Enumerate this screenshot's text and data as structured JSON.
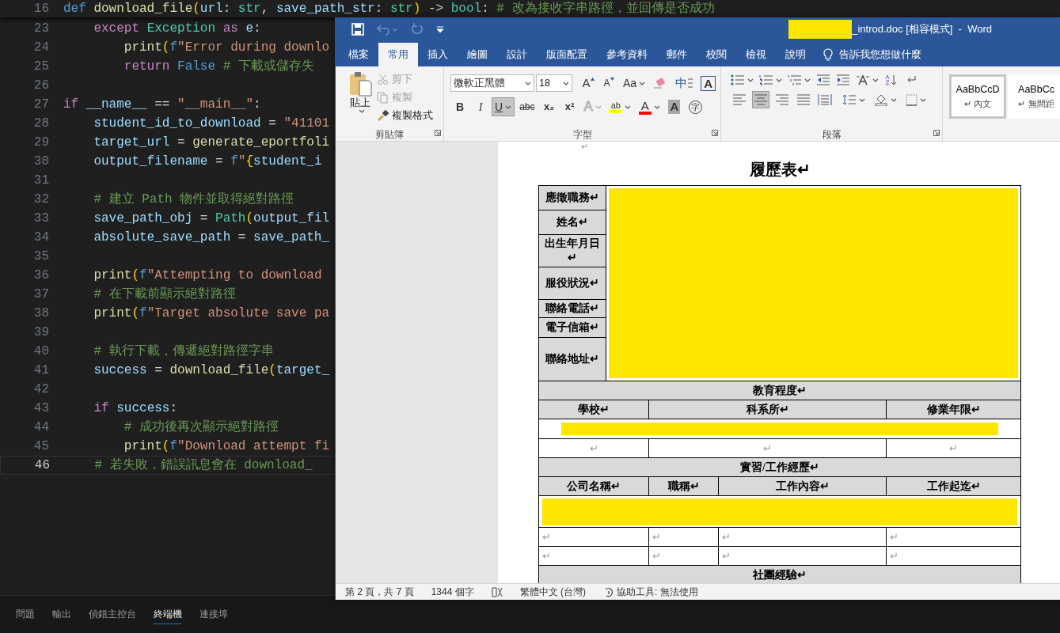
{
  "editor": {
    "sticky_line": {
      "number": "16",
      "current": false,
      "segments": [
        {
          "text": "def ",
          "kind": "keyword"
        },
        {
          "text": "download_file",
          "kind": "function"
        },
        {
          "text": "(",
          "kind": "bracket"
        },
        {
          "text": "url",
          "kind": "variable"
        },
        {
          "text": ": ",
          "kind": "plain"
        },
        {
          "text": "str",
          "kind": "type"
        },
        {
          "text": ", ",
          "kind": "plain"
        },
        {
          "text": "save_path_str",
          "kind": "variable"
        },
        {
          "text": ": ",
          "kind": "plain"
        },
        {
          "text": "str",
          "kind": "type"
        },
        {
          "text": ")",
          "kind": "bracket"
        },
        {
          "text": " -> ",
          "kind": "plain"
        },
        {
          "text": "bool",
          "kind": "type"
        },
        {
          "text": ": ",
          "kind": "plain"
        },
        {
          "text": "# 改為接收字串路徑，並回傳是否成功",
          "kind": "comment"
        }
      ]
    },
    "lines": [
      {
        "number": "23",
        "current": false,
        "segments": [
          {
            "text": "    except ",
            "kind": "control"
          },
          {
            "text": "Exception",
            "kind": "type"
          },
          {
            "text": " as ",
            "kind": "control"
          },
          {
            "text": "e",
            "kind": "variable"
          },
          {
            "text": ":",
            "kind": "plain"
          }
        ]
      },
      {
        "number": "24",
        "current": false,
        "segments": [
          {
            "text": "        print",
            "kind": "function"
          },
          {
            "text": "(",
            "kind": "bracket"
          },
          {
            "text": "f",
            "kind": "keyword"
          },
          {
            "text": "\"Error during downlo",
            "kind": "string"
          }
        ]
      },
      {
        "number": "25",
        "current": false,
        "segments": [
          {
            "text": "        return ",
            "kind": "control"
          },
          {
            "text": "False",
            "kind": "keyword"
          },
          {
            "text": " # 下載或儲存失",
            "kind": "comment"
          }
        ]
      },
      {
        "number": "26",
        "current": false
      },
      {
        "number": "27",
        "current": false,
        "segments": [
          {
            "text": "if ",
            "kind": "control"
          },
          {
            "text": "__name__",
            "kind": "variable"
          },
          {
            "text": " == ",
            "kind": "plain"
          },
          {
            "text": "\"__main__\"",
            "kind": "string"
          },
          {
            "text": ":",
            "kind": "plain"
          }
        ]
      },
      {
        "number": "28",
        "current": false,
        "segments": [
          {
            "text": "    student_id_to_download",
            "kind": "variable"
          },
          {
            "text": " = ",
            "kind": "plain"
          },
          {
            "text": "\"41101",
            "kind": "string"
          }
        ]
      },
      {
        "number": "29",
        "current": false,
        "segments": [
          {
            "text": "    target_url",
            "kind": "variable"
          },
          {
            "text": " = ",
            "kind": "plain"
          },
          {
            "text": "generate_eportfoli",
            "kind": "function"
          }
        ]
      },
      {
        "number": "30",
        "current": false,
        "segments": [
          {
            "text": "    output_filename",
            "kind": "variable"
          },
          {
            "text": " = ",
            "kind": "plain"
          },
          {
            "text": "f",
            "kind": "keyword"
          },
          {
            "text": "\"",
            "kind": "string"
          },
          {
            "text": "{",
            "kind": "bracket"
          },
          {
            "text": "student_i",
            "kind": "variable"
          }
        ]
      },
      {
        "number": "31",
        "current": false
      },
      {
        "number": "32",
        "current": false,
        "segments": [
          {
            "text": "    # 建立 Path 物件並取得絕對路徑",
            "kind": "comment"
          }
        ]
      },
      {
        "number": "33",
        "current": false,
        "segments": [
          {
            "text": "    save_path_obj",
            "kind": "variable"
          },
          {
            "text": " = ",
            "kind": "plain"
          },
          {
            "text": "Path",
            "kind": "type"
          },
          {
            "text": "(",
            "kind": "bracket"
          },
          {
            "text": "output_fil",
            "kind": "variable"
          }
        ]
      },
      {
        "number": "34",
        "current": false,
        "segments": [
          {
            "text": "    absolute_save_path",
            "kind": "variable"
          },
          {
            "text": " = ",
            "kind": "plain"
          },
          {
            "text": "save_path_",
            "kind": "variable"
          }
        ]
      },
      {
        "number": "35",
        "current": false
      },
      {
        "number": "36",
        "current": false,
        "segments": [
          {
            "text": "    print",
            "kind": "function"
          },
          {
            "text": "(",
            "kind": "bracket"
          },
          {
            "text": "f",
            "kind": "keyword"
          },
          {
            "text": "\"Attempting to download",
            "kind": "string"
          }
        ]
      },
      {
        "number": "37",
        "current": false,
        "segments": [
          {
            "text": "    # 在下載前顯示絕對路徑",
            "kind": "comment"
          }
        ]
      },
      {
        "number": "38",
        "current": false,
        "segments": [
          {
            "text": "    print",
            "kind": "function"
          },
          {
            "text": "(",
            "kind": "bracket"
          },
          {
            "text": "f",
            "kind": "keyword"
          },
          {
            "text": "\"Target absolute save pa",
            "kind": "string"
          }
        ]
      },
      {
        "number": "39",
        "current": false
      },
      {
        "number": "40",
        "current": false,
        "segments": [
          {
            "text": "    # 執行下載，傳遞絕對路徑字串",
            "kind": "comment"
          }
        ]
      },
      {
        "number": "41",
        "current": false,
        "segments": [
          {
            "text": "    success",
            "kind": "variable"
          },
          {
            "text": " = ",
            "kind": "plain"
          },
          {
            "text": "download_file",
            "kind": "function"
          },
          {
            "text": "(",
            "kind": "bracket"
          },
          {
            "text": "target_",
            "kind": "variable"
          }
        ]
      },
      {
        "number": "42",
        "current": false
      },
      {
        "number": "43",
        "current": false,
        "segments": [
          {
            "text": "    if ",
            "kind": "control"
          },
          {
            "text": "success",
            "kind": "variable"
          },
          {
            "text": ":",
            "kind": "plain"
          }
        ]
      },
      {
        "number": "44",
        "current": false,
        "segments": [
          {
            "text": "        # 成功後再次顯示絕對路徑",
            "kind": "comment"
          }
        ]
      },
      {
        "number": "45",
        "current": false,
        "segments": [
          {
            "text": "        print",
            "kind": "function"
          },
          {
            "text": "(",
            "kind": "bracket"
          },
          {
            "text": "f",
            "kind": "keyword"
          },
          {
            "text": "\"Download attempt fi",
            "kind": "string"
          }
        ]
      },
      {
        "number": "46",
        "current": true,
        "segments": [
          {
            "text": "    # 若失敗，錯誤訊息會在 download_",
            "kind": "comment"
          }
        ]
      }
    ]
  },
  "panel_tabs": [
    {
      "label": "問題",
      "selected": false
    },
    {
      "label": "輸出",
      "selected": false
    },
    {
      "label": "偵錯主控台",
      "selected": false
    },
    {
      "label": "終端機",
      "selected": true
    },
    {
      "label": "連接埠",
      "selected": false
    }
  ],
  "word": {
    "quick_access": [
      {
        "kind": "save",
        "disabled": false
      },
      {
        "kind": "undo",
        "disabled": true
      },
      {
        "kind": "redo",
        "disabled": true
      },
      {
        "kind": "customize",
        "disabled": false
      }
    ],
    "title": "_introd.doc [相容模式]  -  Word",
    "tabs": [
      {
        "label": "檔案",
        "selected": false
      },
      {
        "label": "常用",
        "selected": true
      },
      {
        "label": "插入",
        "selected": false
      },
      {
        "label": "繪圖",
        "selected": false
      },
      {
        "label": "設計",
        "selected": false
      },
      {
        "label": "版面配置",
        "selected": false
      },
      {
        "label": "參考資料",
        "selected": false
      },
      {
        "label": "郵件",
        "selected": false
      },
      {
        "label": "校閱",
        "selected": false
      },
      {
        "label": "檢視",
        "selected": false
      },
      {
        "label": "說明",
        "selected": false
      }
    ],
    "tell_me": "告訴我您想做什麼",
    "clipboard": {
      "paste": "貼上",
      "items": [
        {
          "label": "剪下",
          "kind": "cut",
          "disabled": true
        },
        {
          "label": "複製",
          "kind": "copy",
          "disabled": true
        },
        {
          "label": "複製格式",
          "kind": "format_painter",
          "disabled": false
        }
      ],
      "label": "剪貼簿"
    },
    "font": {
      "font_name": "微軟正黑體",
      "font_size": "18",
      "label": "字型",
      "row1": [
        {
          "label": "A",
          "kind": "grow",
          "pressed": false
        },
        {
          "label": "A",
          "kind": "shrink",
          "pressed": false
        },
        {
          "label": "Aa",
          "kind": "case",
          "pressed": false
        },
        {
          "kind": "clear",
          "pressed": false
        },
        {
          "label": "中",
          "kind": "phonetic",
          "pressed": false
        },
        {
          "label": "A",
          "kind": "boxed",
          "pressed": false
        }
      ],
      "row2": [
        {
          "label": "B",
          "kind": "bold",
          "pressed": false
        },
        {
          "label": "I",
          "kind": "italic",
          "pressed": false
        },
        {
          "label": "U",
          "kind": "underline",
          "pressed": true
        },
        {
          "label": "abc",
          "kind": "strike",
          "pressed": false
        },
        {
          "label": "x₂",
          "kind": "sub",
          "pressed": false
        },
        {
          "label": "x²",
          "kind": "sup",
          "pressed": false
        },
        {
          "label": "A",
          "kind": "effects",
          "pressed": false
        },
        {
          "label": "ab",
          "kind": "highlight",
          "pressed": false
        },
        {
          "label": "A",
          "kind": "color",
          "pressed": false
        },
        {
          "label": "A",
          "kind": "shaded",
          "pressed": false
        },
        {
          "label": "字",
          "kind": "circled",
          "pressed": false
        }
      ]
    },
    "paragraph": {
      "label": "段落",
      "alignment": [
        {
          "kind": "left",
          "selected": false
        },
        {
          "kind": "center",
          "selected": true
        },
        {
          "kind": "right",
          "selected": false
        },
        {
          "kind": "justify",
          "selected": false
        },
        {
          "kind": "distributed",
          "selected": false
        }
      ]
    },
    "styles": [
      {
        "preview": "AaBbCcD",
        "name": "↵ 內文",
        "selected": true
      },
      {
        "preview": "AaBbCc",
        "name": "↵ 無間距",
        "selected": false
      }
    ],
    "document": {
      "top_mark": "↵",
      "title": "履歷表↵",
      "personal_fields": [
        "應徵職務↵",
        "姓名↵",
        "出生年月日↵",
        "服役狀況↵",
        "聯絡電話↵",
        "電子信箱↵",
        "聯絡地址↵"
      ],
      "sections": [
        {
          "heading": "教育程度↵",
          "columns": [
            "學校↵",
            "科系所↵",
            "修業年限↵"
          ],
          "rows": [
            {
              "kind": "redacted"
            },
            {
              "kind": "cells",
              "cells": [
                "↵",
                "↵",
                "↵"
              ]
            }
          ]
        },
        {
          "heading": "實習/工作經歷↵",
          "columns": [
            "公司名稱↵",
            "職稱↵",
            "工作內容↵",
            "工作起迄↵"
          ],
          "rows": [
            {
              "kind": "redacted"
            },
            {
              "kind": "cells",
              "cells": [
                "↵",
                "↵",
                "↵",
                "↵"
              ]
            },
            {
              "kind": "cells",
              "cells": [
                "↵",
                "↵",
                "↵",
                "↵"
              ]
            }
          ]
        },
        {
          "heading": "社團經驗↵"
        }
      ]
    },
    "status_bar": [
      {
        "kind": "text",
        "label": "第 2 頁，共 7 頁"
      },
      {
        "kind": "text",
        "label": "1344 個字"
      },
      {
        "kind": "proofing"
      },
      {
        "kind": "text",
        "label": "繁體中文 (台灣)"
      },
      {
        "kind": "accessibility",
        "label": "協助工具: 無法使用"
      }
    ]
  }
}
